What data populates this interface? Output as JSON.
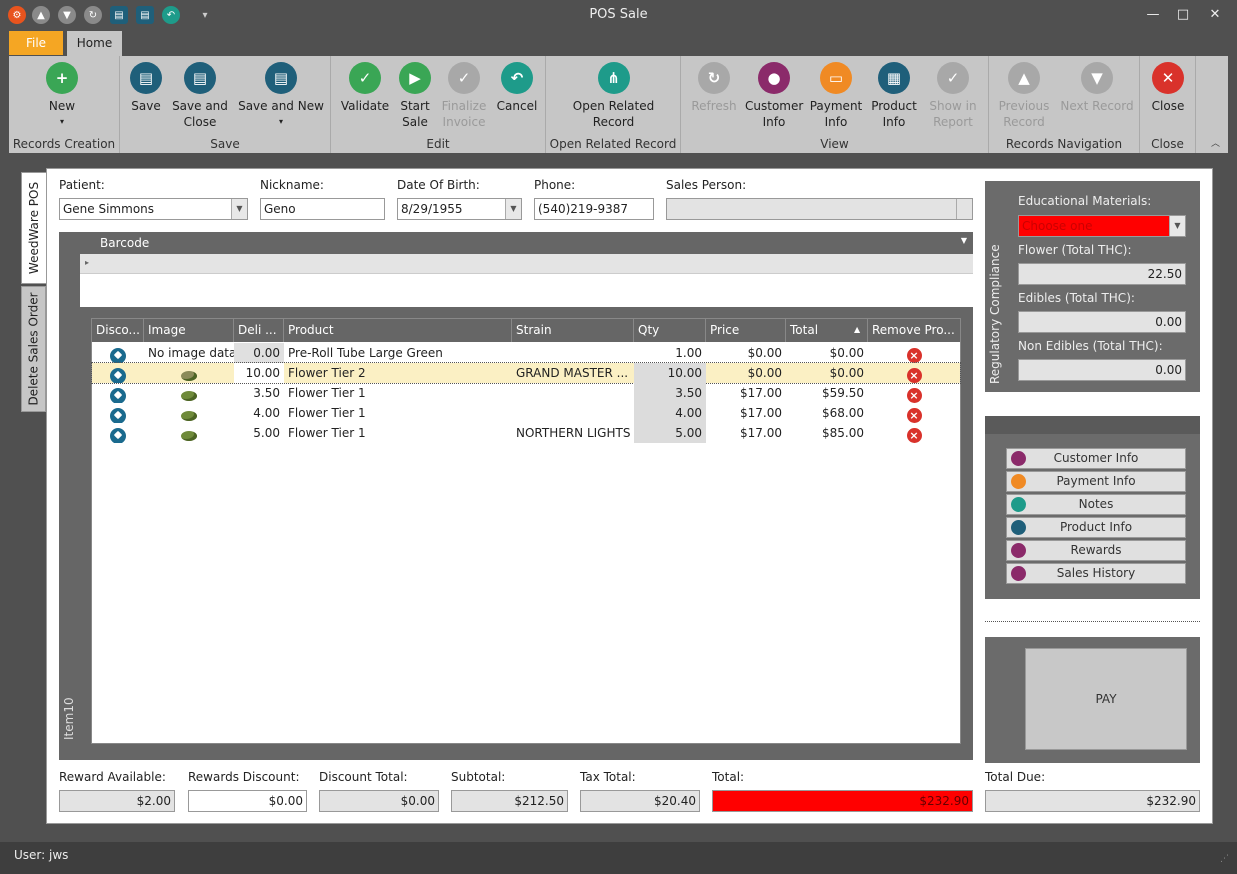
{
  "window": {
    "title": "POS Sale"
  },
  "menu": {
    "file": "File",
    "home": "Home"
  },
  "ribbon": {
    "groups": {
      "records_creation": "Records Creation",
      "save": "Save",
      "edit": "Edit",
      "open_related": "Open Related Record",
      "view": "View",
      "navigation": "Records Navigation",
      "close": "Close"
    },
    "new": "New",
    "save": "Save",
    "save_close": "Save and Close",
    "save_new": "Save and New",
    "validate": "Validate",
    "start_sale": "Start Sale",
    "finalize_invoice": "Finalize Invoice",
    "cancel": "Cancel",
    "open_related": "Open Related Record",
    "refresh": "Refresh",
    "customer_info": "Customer Info",
    "payment_info": "Payment Info",
    "product_info": "Product Info",
    "show_report": "Show in Report",
    "previous_record": "Previous Record",
    "next_record": "Next Record",
    "close": "Close"
  },
  "vtabs": {
    "pos": "WeedWare POS",
    "delete": "Delete Sales Order"
  },
  "form": {
    "patient_label": "Patient:",
    "patient_value": "Gene Simmons",
    "nickname_label": "Nickname:",
    "nickname_value": "Geno",
    "dob_label": "Date Of Birth:",
    "dob_value": "8/29/1955",
    "phone_label": "Phone:",
    "phone_value": "(540)219-9387",
    "salesperson_label": "Sales Person:",
    "salesperson_value": ""
  },
  "barcode": {
    "header": "Barcode"
  },
  "grid": {
    "side_label": "Item10",
    "columns": [
      "Disco...",
      "Image",
      "Deli ...",
      "Product",
      "Strain",
      "Qty",
      "Price",
      "Total",
      "Remove Pro..."
    ],
    "rows": [
      {
        "image": "No image data",
        "deli": "0.00",
        "product": "Pre-Roll Tube Large Green",
        "strain": "",
        "qty": "1.00",
        "price": "$0.00",
        "total": "$0.00"
      },
      {
        "image": "",
        "deli": "10.00",
        "product": "Flower Tier 2",
        "strain": "GRAND MASTER ...",
        "qty": "10.00",
        "price": "$0.00",
        "total": "$0.00"
      },
      {
        "image": "",
        "deli": "3.50",
        "product": "Flower Tier 1",
        "strain": "",
        "qty": "3.50",
        "price": "$17.00",
        "total": "$59.50"
      },
      {
        "image": "",
        "deli": "4.00",
        "product": "Flower Tier 1",
        "strain": "",
        "qty": "4.00",
        "price": "$17.00",
        "total": "$68.00"
      },
      {
        "image": "",
        "deli": "5.00",
        "product": "Flower Tier 1",
        "strain": "NORTHERN LIGHTS",
        "qty": "5.00",
        "price": "$17.00",
        "total": "$85.00"
      }
    ]
  },
  "compliance": {
    "title": "Regulatory Compliance",
    "edu_label": "Educational Materials:",
    "edu_value": "Choose one",
    "flower_label": "Flower (Total THC):",
    "flower_value": "22.50",
    "edibles_label": "Edibles (Total THC):",
    "edibles_value": "0.00",
    "nonedibles_label": "Non Edibles  (Total THC):",
    "nonedibles_value": "0.00"
  },
  "side_buttons": [
    "Customer Info",
    "Payment Info",
    "Notes",
    "Product Info",
    "Rewards",
    "Sales History"
  ],
  "pay": {
    "label": "PAY"
  },
  "totals": {
    "reward_available_label": "Reward Available:",
    "reward_available": "$2.00",
    "rewards_discount_label": "Rewards Discount:",
    "rewards_discount": "$0.00",
    "discount_total_label": "Discount Total:",
    "discount_total": "$0.00",
    "subtotal_label": "Subtotal:",
    "subtotal": "$212.50",
    "tax_total_label": "Tax Total:",
    "tax_total": "$20.40",
    "total_label": "Total:",
    "total": "$232.90",
    "total_due_label": "Total Due:",
    "total_due": "$232.90"
  },
  "status": {
    "user": "User: jws"
  },
  "colors": {
    "accent_orange": "#f5a623",
    "alert_red": "#ff0000",
    "teal": "#1a6a8e",
    "green": "#3aa655"
  }
}
